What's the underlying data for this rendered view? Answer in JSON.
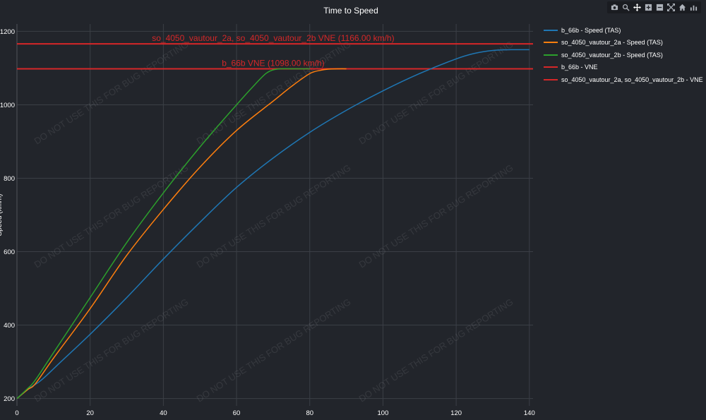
{
  "toolbar": {
    "buttons": [
      {
        "name": "camera-icon"
      },
      {
        "name": "zoom-icon"
      },
      {
        "name": "pan-icon"
      },
      {
        "name": "zoom-in-icon"
      },
      {
        "name": "zoom-out-icon"
      },
      {
        "name": "autoscale-icon"
      },
      {
        "name": "home-icon"
      },
      {
        "name": "plotly-logo-icon"
      }
    ]
  },
  "watermark": "DO NOT USE THIS FOR BUG REPORTING",
  "chart_data": {
    "type": "line",
    "title": "Time to Speed",
    "xlabel": "",
    "ylabel": "Speed (km/h)",
    "xlim": [
      0,
      141
    ],
    "ylim": [
      180,
      1220
    ],
    "x_ticks": [
      0,
      20,
      40,
      60,
      80,
      100,
      120,
      140
    ],
    "y_ticks": [
      200,
      400,
      600,
      800,
      1000,
      1200
    ],
    "grid": true,
    "legend_position": "top-right",
    "background": "#22252b",
    "series": [
      {
        "name": "b_66b - Speed (TAS)",
        "color": "#1f77b4",
        "x": [
          0,
          3,
          6,
          8,
          12,
          20,
          30,
          40,
          50,
          60,
          70,
          80,
          90,
          100,
          110,
          120,
          125,
          130,
          135,
          140
        ],
        "y": [
          200,
          225,
          245,
          262,
          300,
          375,
          475,
          580,
          680,
          775,
          855,
          925,
          985,
          1038,
          1085,
          1125,
          1140,
          1148,
          1150,
          1150
        ]
      },
      {
        "name": "so_4050_vautour_2a - Speed (TAS)",
        "color": "#ff7f0e",
        "x": [
          0,
          3,
          5,
          10,
          20,
          30,
          40,
          50,
          60,
          70,
          75,
          80,
          83,
          85,
          88,
          90
        ],
        "y": [
          200,
          225,
          240,
          310,
          445,
          590,
          715,
          830,
          930,
          1010,
          1050,
          1085,
          1094,
          1097,
          1098,
          1098
        ]
      },
      {
        "name": "so_4050_vautour_2b - Speed (TAS)",
        "color": "#2ca02c",
        "x": [
          0,
          3,
          5,
          10,
          20,
          30,
          40,
          50,
          60,
          65,
          68,
          70,
          72,
          75,
          80
        ],
        "y": [
          200,
          228,
          250,
          325,
          475,
          625,
          760,
          885,
          1000,
          1055,
          1085,
          1095,
          1098,
          1098,
          1098
        ]
      }
    ],
    "reference_lines": [
      {
        "name": "b_66b - VNE",
        "y": 1098,
        "color": "#d62728",
        "annotation": "b_66b VNE (1098.00 km/h)",
        "annotation_x": 70
      },
      {
        "name": "so_4050_vautour_2a, so_4050_vautour_2b - VNE",
        "y": 1166,
        "color": "#d62728",
        "annotation": "so_4050_vautour_2a, so_4050_vautour_2b VNE (1166.00 km/h)",
        "annotation_x": 70
      }
    ]
  }
}
